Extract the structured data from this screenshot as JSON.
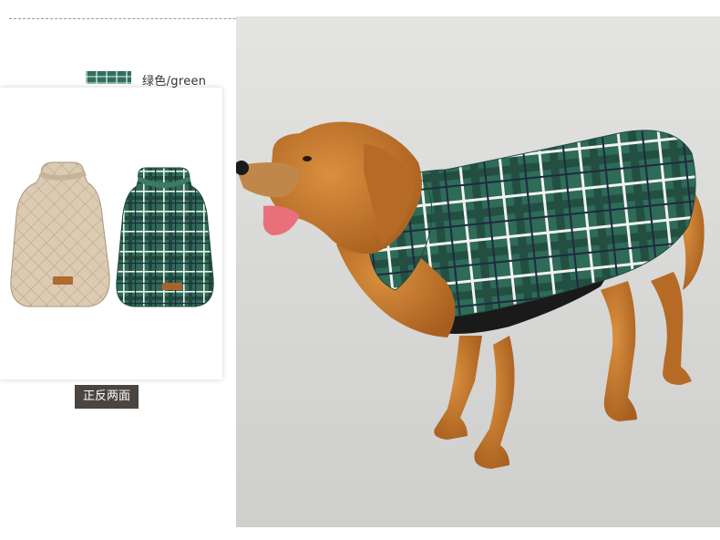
{
  "color_option": {
    "label": "绿色/green",
    "swatch_color": "#2f6f5e"
  },
  "caption": {
    "text": "正反两面"
  },
  "colors": {
    "beige": "#d9c7ae",
    "plaid_green": "#2e6b58",
    "plaid_light": "#f2f2ee",
    "plaid_navy": "#1f2a40",
    "fur": "#c47a2c",
    "caption_bg": "#4b4542"
  },
  "icons": {
    "coat_inside": "quilted-beige-coat",
    "coat_outside": "green-plaid-coat",
    "dog": "golden-retriever-in-plaid-coat"
  }
}
